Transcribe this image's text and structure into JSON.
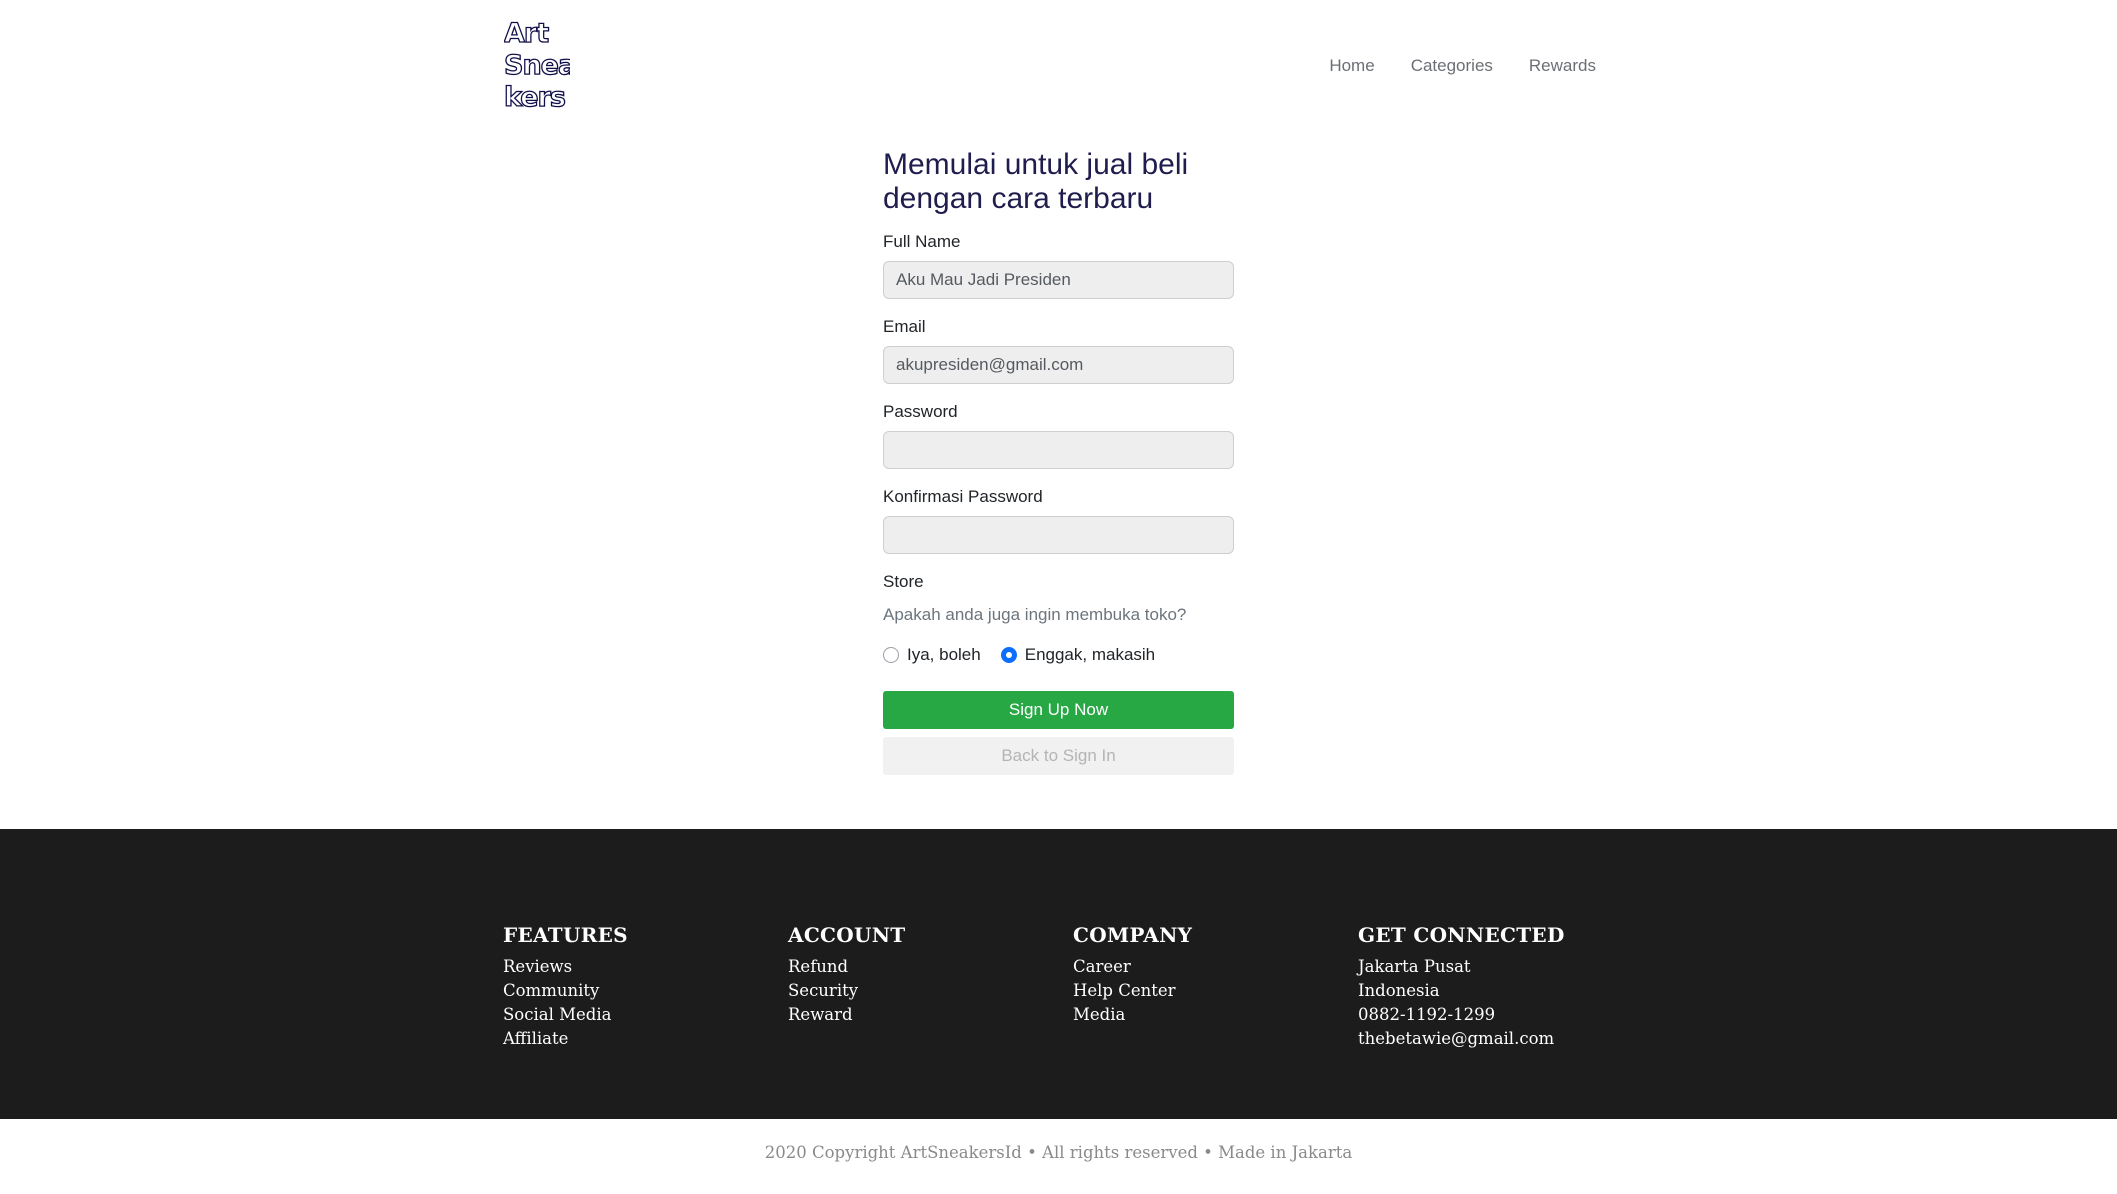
{
  "header": {
    "logo_lines": [
      "Art",
      "Snea",
      "kers"
    ],
    "nav": [
      "Home",
      "Categories",
      "Rewards"
    ]
  },
  "form": {
    "title": "Memulai untuk jual beli dengan cara terbaru",
    "full_name": {
      "label": "Full Name",
      "value": "Aku Mau Jadi Presiden"
    },
    "email": {
      "label": "Email",
      "value": "akupresiden@gmail.com"
    },
    "password": {
      "label": "Password",
      "value": ""
    },
    "confirm_password": {
      "label": "Konfirmasi Password",
      "value": ""
    },
    "store": {
      "label": "Store",
      "question": "Apakah anda juga ingin membuka toko?",
      "options": [
        "Iya, boleh",
        "Enggak, makasih"
      ],
      "selected": "Enggak, makasih"
    },
    "signup_label": "Sign Up Now",
    "back_label": "Back to Sign In"
  },
  "footer": {
    "columns": [
      {
        "title": "FEATURES",
        "items": [
          "Reviews",
          "Community",
          "Social Media",
          "Affiliate"
        ]
      },
      {
        "title": "ACCOUNT",
        "items": [
          "Refund",
          "Security",
          "Reward"
        ]
      },
      {
        "title": "COMPANY",
        "items": [
          "Career",
          "Help Center",
          "Media"
        ]
      },
      {
        "title": "GET CONNECTED",
        "items": [
          "Jakarta Pusat",
          "Indonesia",
          "0882-1192-1299",
          "thebetawie@gmail.com"
        ]
      }
    ],
    "copyright": "2020 Copyright ArtSneakersId • All rights reserved • Made in Jakarta"
  },
  "colors": {
    "primary_button": "#28a745",
    "footer_bg": "#1c1c1c",
    "radio_checked": "#0d6efd",
    "title": "#1f1d4e"
  }
}
